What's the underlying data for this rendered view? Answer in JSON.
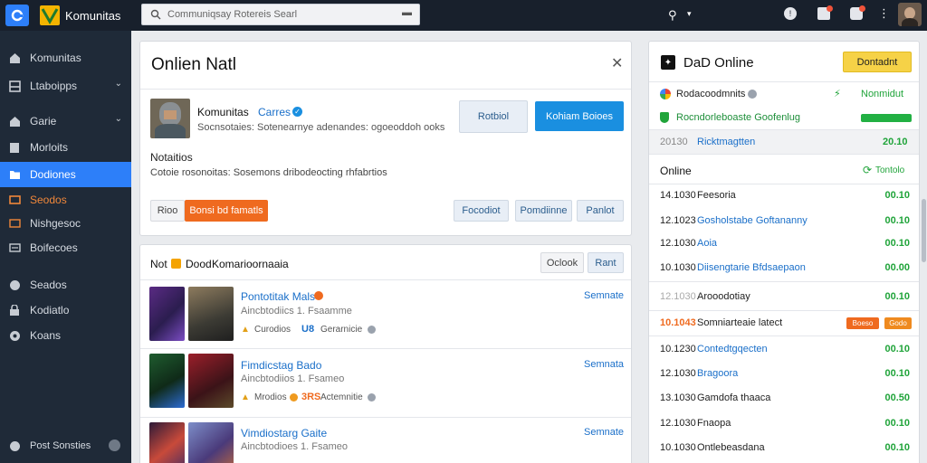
{
  "app": {
    "title": "Komunitas"
  },
  "search": {
    "placeholder": "Communiqsay Rotereis Searl"
  },
  "sidebar": {
    "items": [
      {
        "label": "Komunitas"
      },
      {
        "label": "Ltaboipps"
      },
      {
        "label": "Garie"
      },
      {
        "label": "Morloits"
      },
      {
        "label": "Dodiones"
      },
      {
        "label": "Seodos"
      },
      {
        "label": "Nishgesoc"
      },
      {
        "label": "Boifecoes"
      },
      {
        "label": "Seados"
      },
      {
        "label": "Kodiatlo"
      },
      {
        "label": "Koans"
      }
    ],
    "footer_label": "Post Sonsties"
  },
  "composer": {
    "title": "Onlien Natl",
    "group_name": "Komunitas",
    "group_tag": "Carres",
    "group_desc": "Socnsotaies: Sotenearnye adenandes: ogoeoddoh ooks",
    "btn_follow": "Rotbiol",
    "btn_join": "Kohiam Boioes",
    "notes_label": "Notaitios",
    "notes_text": "Cotoie rosonoitas: Sosemons dribodeocting rhfabrtios",
    "btn_reset": "Rioo",
    "btn_submit": "Bonsi bd famatls",
    "tags": [
      "Focodiot",
      "Pomdiinne",
      "Panlot"
    ]
  },
  "list": {
    "header": "Not",
    "header_badge": "Dood",
    "header_text": "Komarioornaaia",
    "btn_clear": "Oclook",
    "btn_read": "Rant",
    "items": [
      {
        "title": "Pontotitak Mals",
        "subtitle": "Aincbtodiics 1. Fsaamme",
        "meta1": "Curodios",
        "meta2": "U8",
        "meta3": "Gerarnicie",
        "action": "Semnate"
      },
      {
        "title": "Fimdicstag Bado",
        "subtitle": "Aincbtodiios 1. Fsameo",
        "meta1": "Mrodios",
        "meta2": "3RS",
        "meta3": "Actemnitie",
        "action": "Semnata"
      },
      {
        "title": "Vimdiostarg Gaite",
        "subtitle": "Aincbtodioes 1. Fsameo",
        "meta1": "",
        "meta2": "",
        "meta3": "",
        "action": "Semnate"
      }
    ]
  },
  "online": {
    "title": "DaD Online",
    "btn": "Dontadnt",
    "row1_name": "Rodacoodmnits",
    "row1_right": "Nonmidut",
    "row2_name": "Rocndorleboaste Goofenlug",
    "row3_time": "20130",
    "row3_name": "Ricktmagtten",
    "row3_val": "20.10",
    "section_label": "Online",
    "section_right": "Tontolo",
    "rows": [
      {
        "time": "14.1030",
        "name": "Feesoria",
        "val": "00.10"
      },
      {
        "time": "12.1023",
        "name": "Gosholstabe Goftananny",
        "val": "00.10"
      },
      {
        "time": "12.1030",
        "name": "Aoia",
        "val": "00.10"
      },
      {
        "time": "10.1030",
        "name": "Diisengtarie Bfdsaepaon",
        "val": "00.00"
      },
      {
        "time": "12.1030",
        "name": "Arooodotiay",
        "val": "00.10"
      },
      {
        "time": "10.1043",
        "name": "Somniarteaie latect",
        "val": "Boeso",
        "val2": "Godo"
      },
      {
        "time": "10.1230",
        "name": "Contedtgqecten",
        "val": "00.10"
      },
      {
        "time": "12.1030",
        "name": "Bragoora",
        "val": "00.10"
      },
      {
        "time": "13.1030",
        "name": "Gamdofa thaaca",
        "val": "00.50"
      },
      {
        "time": "12.1030",
        "name": "Fnaopa",
        "val": "00.10"
      },
      {
        "time": "10.1030",
        "name": "Ontlebeasdana",
        "val": "00.10"
      }
    ]
  }
}
